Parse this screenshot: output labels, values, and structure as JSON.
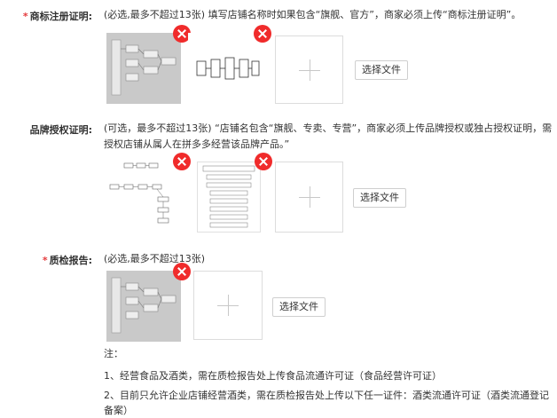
{
  "trademark": {
    "required_mark": "*",
    "label": "商标注册证明:",
    "desc": "(必选,最多不超过13张) 填写店铺名称时如果包含“旗舰、官方”，商家必须上传“商标注册证明”。",
    "choose_button": "选择文件"
  },
  "brand": {
    "label": "品牌授权证明:",
    "desc": "(可选，最多不超过13张) “店铺名包含“旗舰、专卖、专营”，商家必须上传品牌授权或独占授权证明，需授权店铺从属人在拼多多经营该品牌产品。”",
    "choose_button": "选择文件"
  },
  "quality": {
    "required_mark": "*",
    "label": "质检报告:",
    "desc": "(必选,最多不超过13张)",
    "choose_button": "选择文件"
  },
  "notes": {
    "title": "注：",
    "items": [
      "1、经营食品及酒类，需在质检报告处上传食品流通许可证（食品经营许可证）",
      "2、目前只允许企业店铺经营酒类，需在质检报告处上传以下任一证件：酒类流通许可证（酒类流通登记备案）"
    ]
  },
  "icons": {
    "delete": "close-circle-icon",
    "add": "plus-icon"
  },
  "colors": {
    "delete": "#f02b2b",
    "required": "#e4393c"
  }
}
